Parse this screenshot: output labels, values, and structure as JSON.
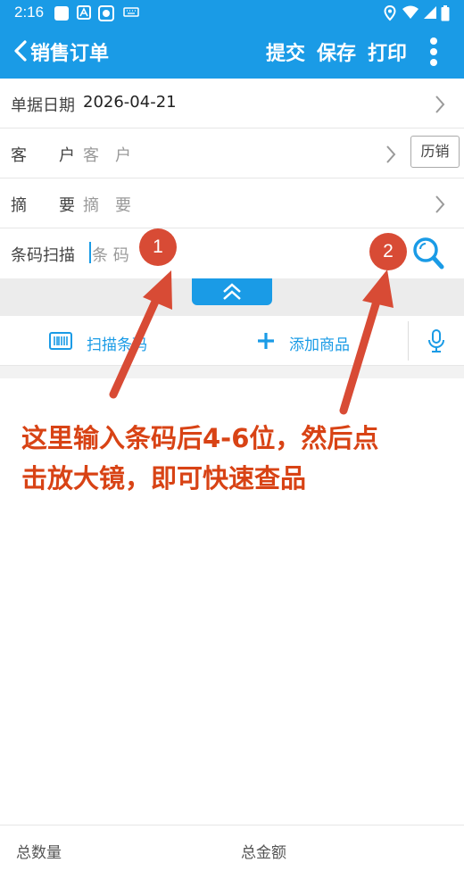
{
  "status_bar": {
    "time": "2:16"
  },
  "app_bar": {
    "title": "销售订单",
    "submit": "提交",
    "save": "保存",
    "print": "打印"
  },
  "form": {
    "date": {
      "label": "单据日期",
      "value": "2026-04-21"
    },
    "customer": {
      "label": "客　　户",
      "placeholder": "客　户",
      "history_button": "历销"
    },
    "summary": {
      "label": "摘　　要",
      "placeholder": "摘　要"
    },
    "barcode": {
      "label": "条码扫描",
      "placeholder": "条 码"
    }
  },
  "toolbar": {
    "scan": "扫描条码",
    "add": "添加商品"
  },
  "footer": {
    "qty": "总数量",
    "amount": "总金额"
  },
  "annotation": {
    "line1": "这里输入条码后4-6位，然后点",
    "line2": "击放大镜，即可快速查品",
    "badge1": "1",
    "badge2": "2"
  },
  "colors": {
    "primary": "#1a9be6",
    "annotation": "#d84315",
    "badge": "#d84b35"
  }
}
